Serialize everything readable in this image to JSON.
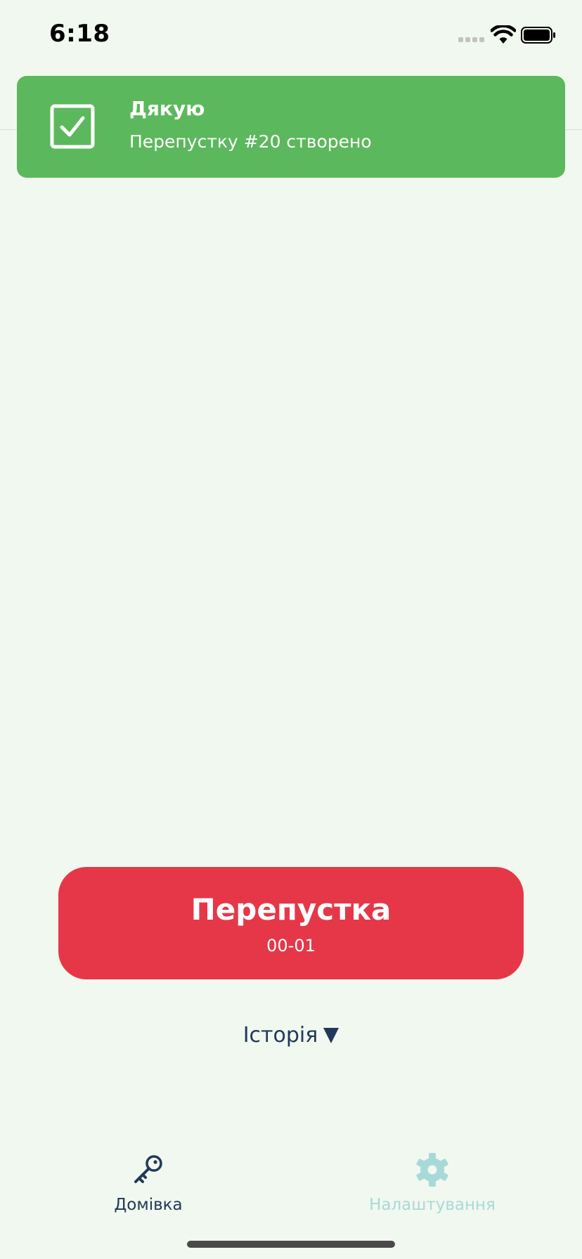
{
  "status_bar": {
    "time": "6:18"
  },
  "toast": {
    "title": "Дякую",
    "message": "Перепустку #20 створено",
    "icon": "checkbox-checked-icon",
    "color": "#5cb85c"
  },
  "pass_button": {
    "title": "Перепустка",
    "code": "00-01",
    "color": "#e63748"
  },
  "history": {
    "label": "Історія",
    "icon": "triangle-down-icon"
  },
  "tab_bar": {
    "tabs": [
      {
        "label": "Домівка",
        "icon": "key-icon",
        "active": true
      },
      {
        "label": "Налаштування",
        "icon": "gear-icon",
        "active": false
      }
    ]
  },
  "colors": {
    "background": "#f1f8ef",
    "accent_dark": "#22385a",
    "inactive_tab": "#a8d9d9"
  }
}
